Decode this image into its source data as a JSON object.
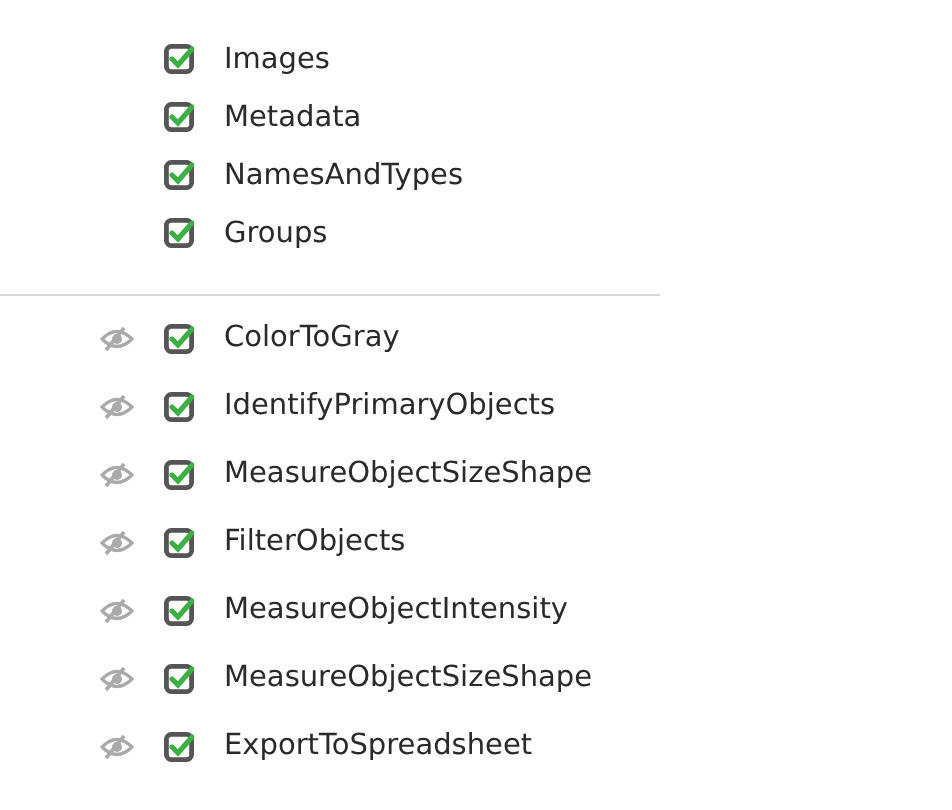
{
  "input_modules": [
    {
      "name": "Images",
      "enabled": true
    },
    {
      "name": "Metadata",
      "enabled": true
    },
    {
      "name": "NamesAndTypes",
      "enabled": true
    },
    {
      "name": "Groups",
      "enabled": true
    }
  ],
  "analysis_modules": [
    {
      "name": "ColorToGray",
      "enabled": true,
      "show_window": false
    },
    {
      "name": "IdentifyPrimaryObjects",
      "enabled": true,
      "show_window": false
    },
    {
      "name": "MeasureObjectSizeShape",
      "enabled": true,
      "show_window": false
    },
    {
      "name": "FilterObjects",
      "enabled": true,
      "show_window": false
    },
    {
      "name": "MeasureObjectIntensity",
      "enabled": true,
      "show_window": false
    },
    {
      "name": "MeasureObjectSizeShape",
      "enabled": true,
      "show_window": false
    },
    {
      "name": "ExportToSpreadsheet",
      "enabled": true,
      "show_window": false
    }
  ]
}
